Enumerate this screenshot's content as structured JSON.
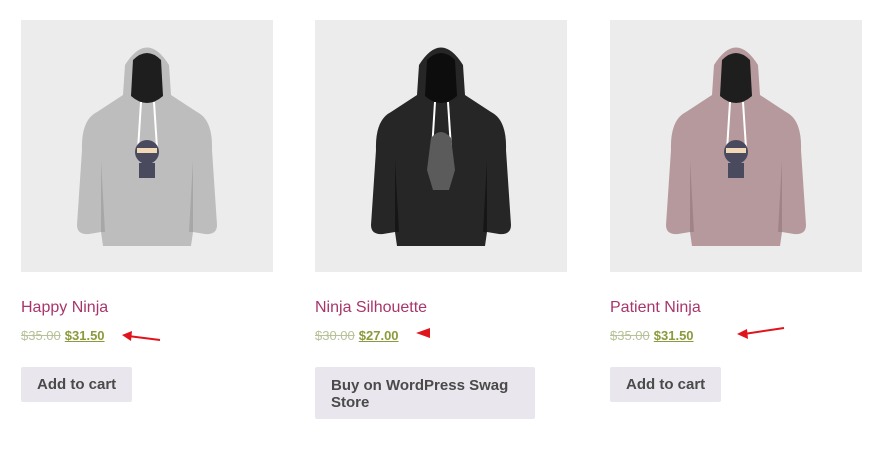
{
  "products": [
    {
      "name": "Happy Ninja",
      "old_price": "$35.00",
      "sale_price": "$31.50",
      "button_label": "Add to cart",
      "hoodie_color": "#bdbdbd",
      "hoodie_shade": "#a7a7a7"
    },
    {
      "name": "Ninja Silhouette",
      "old_price": "$30.00",
      "sale_price": "$27.00",
      "button_label": "Buy on WordPress Swag Store",
      "hoodie_color": "#262626",
      "hoodie_shade": "#161616"
    },
    {
      "name": "Patient Ninja",
      "old_price": "$35.00",
      "sale_price": "$31.50",
      "button_label": "Add to cart",
      "hoodie_color": "#b6999d",
      "hoodie_shade": "#9f8387"
    }
  ],
  "annotation_arrow_color": "#e0141b"
}
